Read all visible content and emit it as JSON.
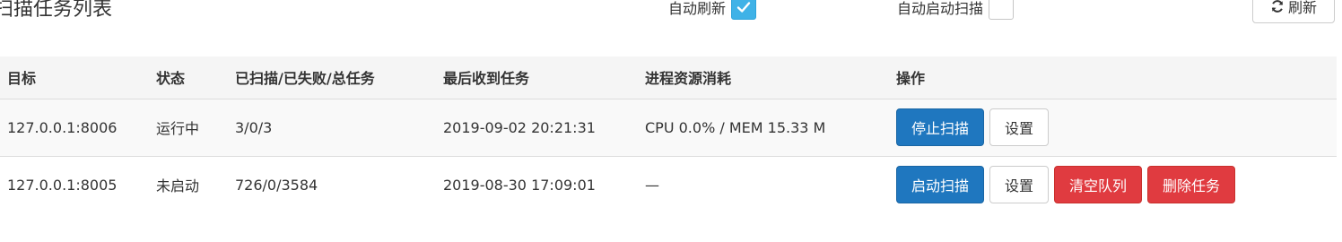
{
  "header": {
    "title": "扫描任务列表",
    "auto_refresh_label": "自动刷新",
    "auto_refresh_checked": true,
    "auto_start_label": "自动启动扫描",
    "auto_start_checked": false,
    "refresh_label": "刷新",
    "refresh_icon": "refresh-icon",
    "check_icon": "check-icon"
  },
  "table": {
    "columns": [
      "目标",
      "状态",
      "已扫描/已失败/总任务",
      "最后收到任务",
      "进程资源消耗",
      "操作"
    ],
    "rows": [
      {
        "target": "127.0.0.1:8006",
        "status": "运行中",
        "progress": "3/0/3",
        "last_task": "2019-09-02 20:21:31",
        "resources": "CPU 0.0% / MEM 15.33 M",
        "actions": [
          "停止扫描",
          "设置"
        ]
      },
      {
        "target": "127.0.0.1:8005",
        "status": "未启动",
        "progress": "726/0/3584",
        "last_task": "2019-08-30 17:09:01",
        "resources": "—",
        "actions": [
          "启动扫描",
          "设置",
          "清空队列",
          "删除任务"
        ]
      }
    ]
  },
  "colors": {
    "primary": "#1f77bf",
    "danger": "#e03b40",
    "checkbox_checked": "#3fb2e7",
    "header_bg": "#f5f5f5"
  }
}
